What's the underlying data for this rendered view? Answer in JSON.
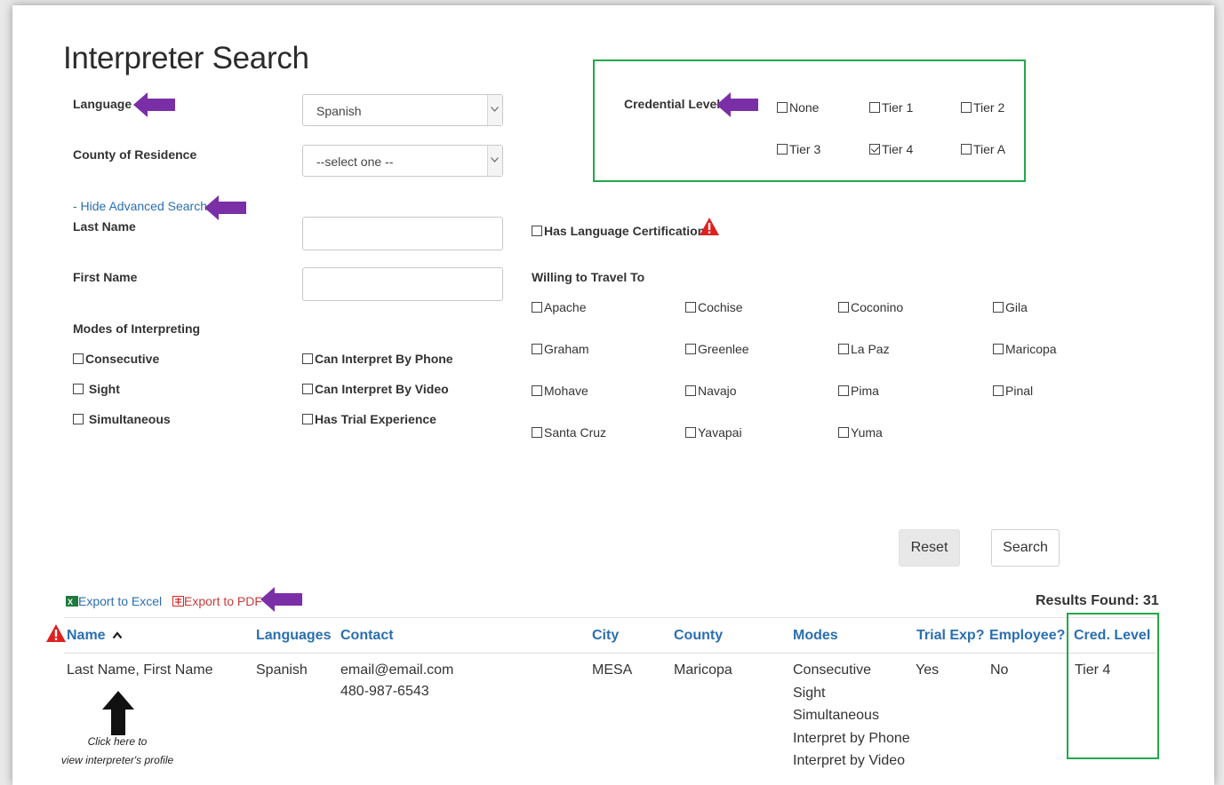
{
  "page": {
    "title": "Interpreter Search"
  },
  "search": {
    "language_label": "Language",
    "language_value": "Spanish",
    "county_label": "County of Residence",
    "county_value": "--select one --",
    "advanced_toggle": "- Hide Advanced Search",
    "last_name_label": "Last Name",
    "first_name_label": "First Name",
    "modes_label": "Modes of Interpreting",
    "modes": [
      {
        "label": "Consecutive",
        "checked": false
      },
      {
        "label": "Sight",
        "checked": false
      },
      {
        "label": "Simultaneous",
        "checked": false
      }
    ],
    "remote": [
      {
        "label": "Can Interpret By Phone",
        "checked": false
      },
      {
        "label": "Can Interpret By Video",
        "checked": false
      },
      {
        "label": "Has Trial Experience",
        "checked": false
      }
    ],
    "has_certification_label": "Has Language Certification",
    "travel_label": "Willing to Travel To",
    "counties": [
      "Apache",
      "Cochise",
      "Coconino",
      "Gila",
      "Graham",
      "Greenlee",
      "La Paz",
      "Maricopa",
      "Mohave",
      "Navajo",
      "Pima",
      "Pinal",
      "Santa Cruz",
      "Yavapai",
      "Yuma"
    ],
    "credential_label": "Credential Level",
    "credentials": [
      {
        "label": "None",
        "checked": false
      },
      {
        "label": "Tier 1",
        "checked": false
      },
      {
        "label": "Tier 2",
        "checked": false
      },
      {
        "label": "Tier 3",
        "checked": false
      },
      {
        "label": "Tier 4",
        "checked": true
      },
      {
        "label": "Tier A",
        "checked": false
      }
    ],
    "reset_label": "Reset",
    "search_label": "Search"
  },
  "results": {
    "export_excel": "Export to Excel",
    "export_pdf": "Export to PDF",
    "found_text": "Results Found: 31",
    "columns": {
      "name": "Name",
      "languages": "Languages",
      "contact": "Contact",
      "city": "City",
      "county": "County",
      "modes": "Modes",
      "trial": "Trial Exp?",
      "employee": "Employee?",
      "cred": "Cred. Level"
    },
    "rows": [
      {
        "name": "Last Name, First Name",
        "languages": "Spanish",
        "email": "email@email.com",
        "phone": "480-987-6543",
        "city": "MESA",
        "county": "Maricopa",
        "modes": [
          "Consecutive",
          "Sight",
          "Simultaneous",
          "Interpret by Phone",
          "Interpret by Video"
        ],
        "trial": "Yes",
        "employee": "No",
        "cred": "Tier 4"
      }
    ]
  },
  "annotations": {
    "note_line1": "Click here to",
    "note_line2": "view interpreter's profile",
    "arrow_color": "#7b2fa6",
    "highlight_color": "#22a84a",
    "warning_color": "#e02020"
  }
}
